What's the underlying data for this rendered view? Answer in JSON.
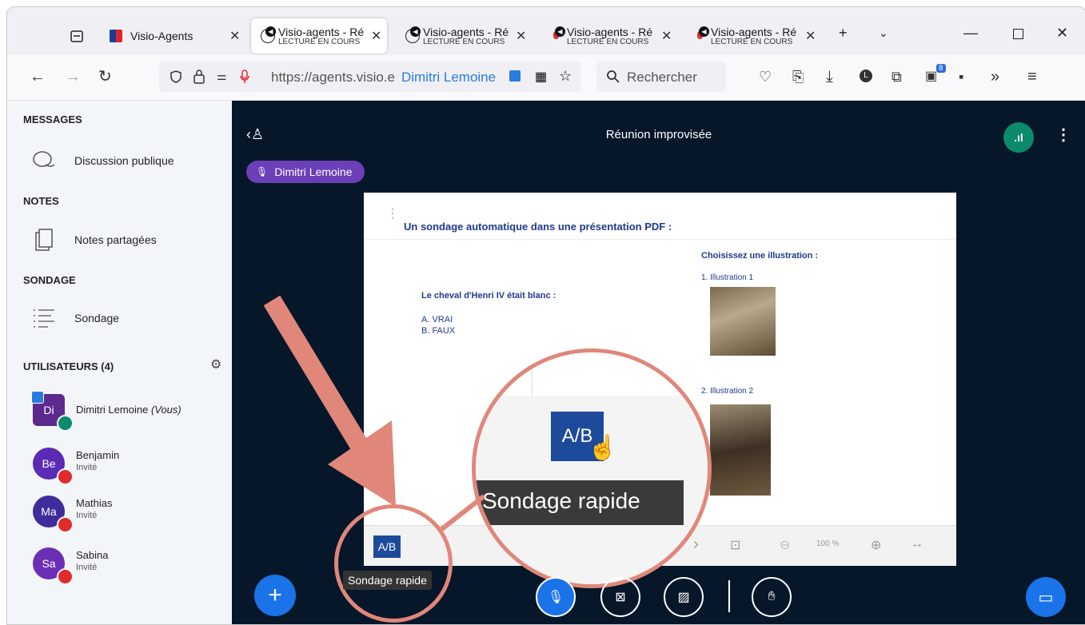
{
  "browser": {
    "tabs": [
      {
        "title": "Visio-Agents",
        "subtitle": ""
      },
      {
        "title": "Visio-agents - Ré",
        "subtitle": "LECTURE EN COURS"
      },
      {
        "title": "Visio-agents - Ré",
        "subtitle": "LECTURE EN COURS"
      },
      {
        "title": "Visio-agents - Ré",
        "subtitle": "LECTURE EN COURS"
      },
      {
        "title": "Visio-agents - Ré",
        "subtitle": "LECTURE EN COURS"
      }
    ],
    "url": "https://agents.visio.e",
    "url_user": "Dimitri Lemoine",
    "search_placeholder": "Rechercher",
    "notification_count": "8"
  },
  "sidebar": {
    "messages_header": "MESSAGES",
    "public_chat": "Discussion publique",
    "notes_header": "NOTES",
    "shared_notes": "Notes partagées",
    "poll_header": "SONDAGE",
    "poll_item": "Sondage",
    "users_header": "UTILISATEURS (4)",
    "users": [
      {
        "initials": "Di",
        "name": "Dimitri Lemoine",
        "suffix": "(Vous)",
        "role": "",
        "color": "#5c2a8c"
      },
      {
        "initials": "Be",
        "name": "Benjamin",
        "suffix": "",
        "role": "Invité",
        "color": "#5b2bb5"
      },
      {
        "initials": "Ma",
        "name": "Mathias",
        "suffix": "",
        "role": "Invité",
        "color": "#3d2d9a"
      },
      {
        "initials": "Sa",
        "name": "Sabina",
        "suffix": "",
        "role": "Invité",
        "color": "#6a2fb5"
      }
    ]
  },
  "meeting": {
    "title": "Réunion improvisée",
    "speaker": "Dimitri Lemoine"
  },
  "slide": {
    "title": "Un sondage automatique dans une présentation PDF :",
    "question": "Le cheval d'Henri IV était blanc :",
    "answer_a": "A. VRAI",
    "answer_b": "B. FAUX",
    "choose": "Choisissez une illustration :",
    "illus1": "1.   Illustration 1",
    "illus2": "2.   Illustration 2",
    "zoom": "100 %"
  },
  "poll_button": {
    "label": "A/B",
    "tooltip": "Sondage rapide"
  },
  "colors": {
    "accent": "#0f70d7",
    "annotation": "#e0877a",
    "sidebar_bg": "#f3f6f9",
    "main_bg": "#06172a"
  }
}
